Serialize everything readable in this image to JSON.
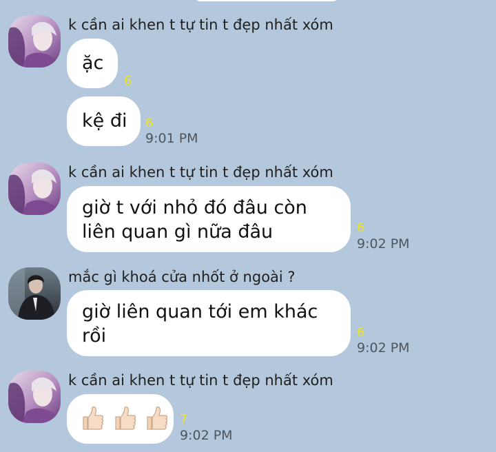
{
  "colors": {
    "background": "#b3c8dc",
    "bubble": "#ffffff",
    "unread_count": "#f2e21f",
    "timestamp": "#4c5560"
  },
  "messages": [
    {
      "sender": "k cần ai khen t tự tin t đẹp nhất xóm",
      "avatar": "avatar-girl-purple",
      "bubbles": [
        {
          "lines": [
            "ặc"
          ],
          "count": "6",
          "time": ""
        },
        {
          "lines": [
            "kệ đi"
          ],
          "count": "6",
          "time": "9:01 PM"
        }
      ]
    },
    {
      "sender": "k cần ai khen t tự tin t đẹp nhất xóm",
      "avatar": "avatar-girl-purple",
      "bubbles": [
        {
          "lines": [
            "giờ t với nhỏ đó đâu còn",
            "liên quan gì nữa đâu"
          ],
          "count": "6",
          "time": "9:02 PM"
        }
      ]
    },
    {
      "sender": "mắc gì khoá cửa nhốt ở ngoài ?",
      "avatar": "avatar-boy-dark",
      "bubbles": [
        {
          "lines": [
            "giờ liên quan tới em khác",
            "rồi"
          ],
          "count": "6",
          "time": "9:02 PM"
        }
      ]
    },
    {
      "sender": "k cần ai khen t tự tin t đẹp nhất xóm",
      "avatar": "avatar-girl-purple",
      "bubbles": [
        {
          "emoji": "thumbs-up-light-skin-tone-x3",
          "count": "7",
          "time": "9:02 PM"
        }
      ]
    }
  ]
}
